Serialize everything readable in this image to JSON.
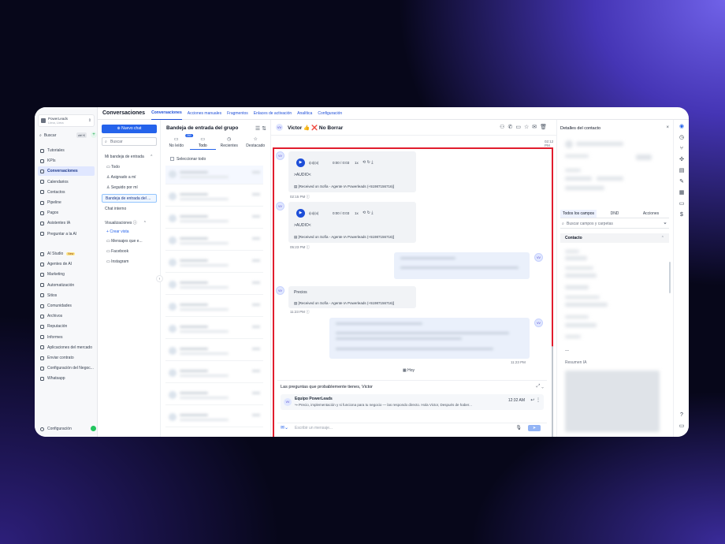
{
  "account": {
    "name": "PowerLeads",
    "location": "Lima, Lima"
  },
  "sidebar": {
    "search_label": "Buscar",
    "search_kbd": "ctrl K",
    "items": [
      {
        "label": "Tutoriales",
        "icon": "book-icon"
      },
      {
        "label": "KPIs",
        "icon": "chart-icon"
      },
      {
        "label": "Conversaciones",
        "icon": "chat-icon",
        "active": true
      },
      {
        "label": "Calendarios",
        "icon": "calendar-icon"
      },
      {
        "label": "Contactos",
        "icon": "contacts-icon"
      },
      {
        "label": "Pipeline",
        "icon": "funnel-icon"
      },
      {
        "label": "Pagos",
        "icon": "payment-icon"
      },
      {
        "label": "Asistentes IA",
        "icon": "robot-icon"
      },
      {
        "label": "Preguntar a la AI",
        "icon": "sparkle-icon"
      }
    ],
    "items2": [
      {
        "label": "AI Studio",
        "icon": "studio-icon",
        "badge": "New"
      },
      {
        "label": "Agentes de AI",
        "icon": "agent-icon"
      },
      {
        "label": "Marketing",
        "icon": "megaphone-icon"
      },
      {
        "label": "Automatización",
        "icon": "automation-icon"
      },
      {
        "label": "Sitios",
        "icon": "globe-icon"
      },
      {
        "label": "Comunidades",
        "icon": "community-icon"
      },
      {
        "label": "Archivos",
        "icon": "folder-icon"
      },
      {
        "label": "Reputación",
        "icon": "star-icon"
      },
      {
        "label": "Informes",
        "icon": "report-icon"
      },
      {
        "label": "Aplicaciones del mercado",
        "icon": "apps-icon"
      },
      {
        "label": "Enviar contrato",
        "icon": "contract-icon"
      },
      {
        "label": "Configuración del Negoc...",
        "icon": "settings-icon"
      },
      {
        "label": "Whatsapp",
        "icon": "whatsapp-icon"
      }
    ],
    "config_label": "Configuración"
  },
  "topbar": {
    "title": "Conversaciones",
    "tabs": [
      "Conversaciones",
      "Acciones manuales",
      "Fragmentos",
      "Enlaces de activación",
      "Analítica",
      "Configuración"
    ]
  },
  "inbox": {
    "new_chat": "Nuevo chat",
    "search_placeholder": "Buscar",
    "my_inbox": "Mi bandeja de entrada",
    "all": "Todo",
    "assigned": "Asignado a mí",
    "following": "Seguido por mí",
    "group_inbox": "Bandeja de entrada del ...",
    "internal_chat": "Chat interno",
    "views": "Visualizaciones",
    "create_view": "Crear vista",
    "views_items": [
      "Mensajes que e...",
      "Facebook",
      "Instagram"
    ]
  },
  "convlist": {
    "title": "Bandeja de entrada del grupo",
    "tabs": [
      {
        "label": "No leído",
        "badge": "260"
      },
      {
        "label": "Todo"
      },
      {
        "label": "Recientes"
      },
      {
        "label": "Destacado"
      }
    ],
    "select_all": "Seleccionar todo"
  },
  "chat": {
    "contact_initials": "VV",
    "contact_name": "Victor 👍 ❌ No Borrar",
    "top_time": "02:12 PM",
    "audio_time": "0:00 / 0:03",
    "speed": "1x",
    "audio_label": ">AUDIO<",
    "received": "[Received on Sofía - Agente IA Powerleads (+51987156716)]",
    "t1": "02:15 PM",
    "t2": "05:23 PM",
    "precios": "Precios",
    "t3": "11:23 PM",
    "t4": "11:23 PM",
    "day": "Hoy"
  },
  "suggest": {
    "title": "Las preguntas que probablemente tienes, Victor",
    "from": "Equipo PowerLeads",
    "text": "Precio, implementación y si funciona para tu negocio — las respondo directo. Hola Victor, Después de haber...",
    "time": "12:32 AM"
  },
  "composer": {
    "placeholder": "Escribir un mensaje..."
  },
  "details": {
    "title": "Detalles del contacto",
    "tabs": [
      "Todos los campos",
      "DND",
      "Acciones"
    ],
    "search_placeholder": "Buscar campos y carpetas",
    "contact_section": "Contacto",
    "dash": "—",
    "ia_summary": "Resumen IA"
  }
}
